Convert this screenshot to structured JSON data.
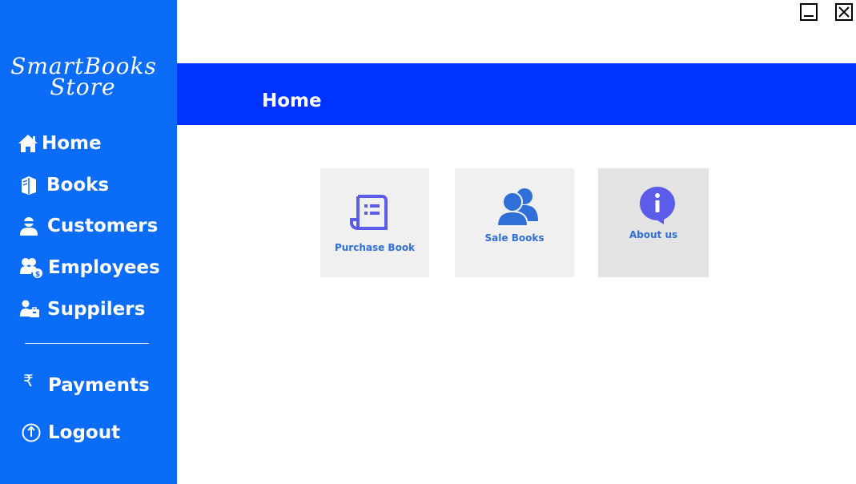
{
  "app": {
    "logo_line1": "SmartBooks",
    "logo_line2": "Store"
  },
  "sidebar": {
    "items": [
      {
        "label": "Home",
        "icon": "home-icon"
      },
      {
        "label": "Books",
        "icon": "books-icon"
      },
      {
        "label": "Customers",
        "icon": "customer-icon"
      },
      {
        "label": "Employees",
        "icon": "employees-icon"
      },
      {
        "label": "Suppilers",
        "icon": "supplier-icon"
      }
    ],
    "bottom_items": [
      {
        "label": "Payments",
        "icon": "rupee-icon"
      },
      {
        "label": "Logout",
        "icon": "power-icon"
      }
    ]
  },
  "header": {
    "title": "Home"
  },
  "tiles": [
    {
      "label": "Purchase Book",
      "icon": "receipt-icon"
    },
    {
      "label": "Sale Books",
      "icon": "users-icon"
    },
    {
      "label": "About us",
      "icon": "info-icon"
    }
  ],
  "colors": {
    "sidebar": "#0b6cf7",
    "header": "#0033ff",
    "tile_bg": "#f0f0f0",
    "tile_label": "#2f6fd8",
    "icon_purple": "#5b5ce8"
  }
}
